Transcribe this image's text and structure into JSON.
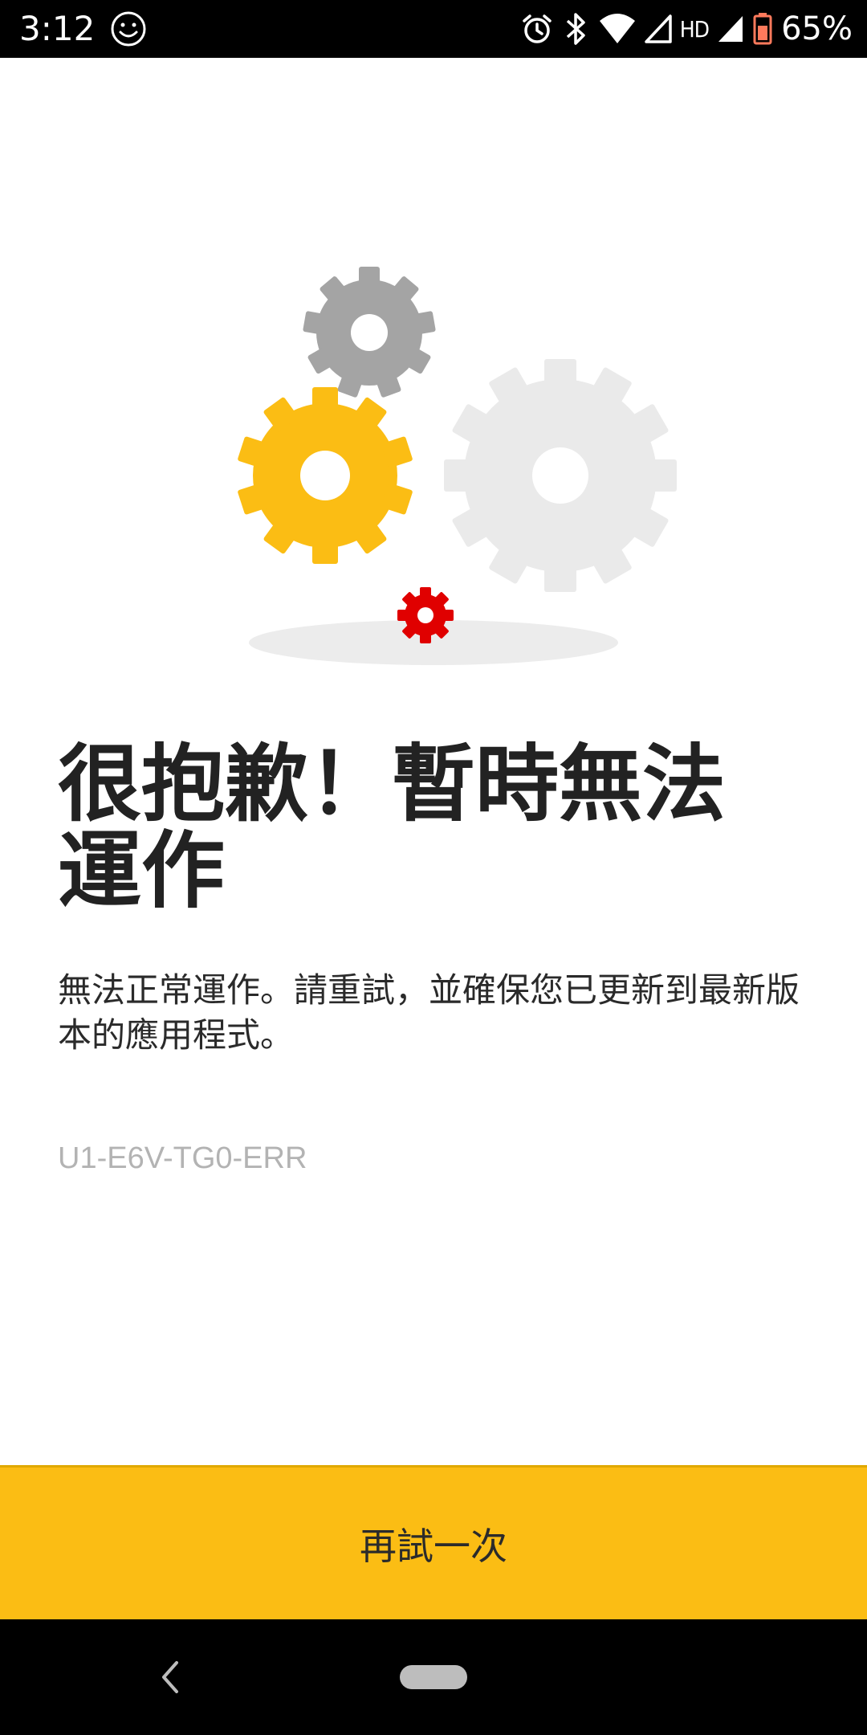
{
  "status_bar": {
    "time": "3:12",
    "hd_label": "HD",
    "battery_percent": "65%",
    "icons": [
      "smiley-icon",
      "alarm-icon",
      "bluetooth-icon",
      "wifi-icon",
      "signal-icon",
      "battery-icon"
    ]
  },
  "error_page": {
    "title": "很抱歉！暫時無法運作",
    "message": "無法正常運作。請重試，並確保您已更新到最新版本的應用程式。",
    "error_code": "U1-E6V-TG0-ERR",
    "illustration_icons": [
      "gear-gray-icon",
      "gear-yellow-icon",
      "gear-lightgray-icon",
      "gear-red-icon"
    ]
  },
  "actions": {
    "retry_label": "再試一次"
  },
  "nav_bar": {
    "icons": [
      "back-icon",
      "home-pill-icon"
    ]
  },
  "colors": {
    "accent": "#FBBD14",
    "gear_gray": "#A4A4A4",
    "gear_light": "#EAEAEA",
    "gear_red": "#E00000",
    "title_text": "#222222",
    "code_text": "#B3B3B3"
  }
}
